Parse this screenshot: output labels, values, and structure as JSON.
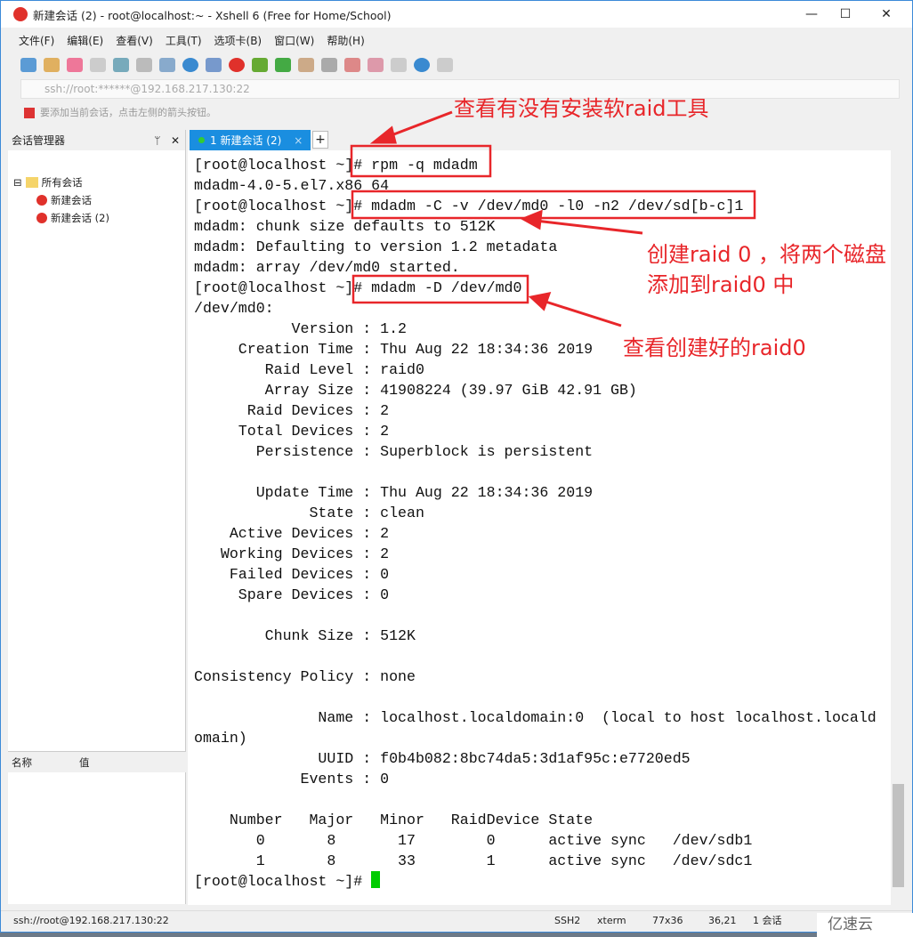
{
  "window": {
    "title": "新建会话 (2) - root@localhost:~ - Xshell 6 (Free for Home/School)",
    "controls": [
      "—",
      "☐",
      "✕"
    ]
  },
  "menu": [
    "文件(F)",
    "编辑(E)",
    "查看(V)",
    "工具(T)",
    "选项卡(B)",
    "窗口(W)",
    "帮助(H)"
  ],
  "address": "ssh://root:******@192.168.217.130:22",
  "hint": "要添加当前会话，点击左侧的箭头按钮。",
  "session_manager": {
    "title": "会话管理器",
    "pin": "ᛘ",
    "close": "✕",
    "root": "所有会话",
    "items": [
      "新建会话",
      "新建会话 (2)"
    ],
    "props_cols": [
      "名称",
      "值"
    ]
  },
  "tab": {
    "label": "1 新建会话 (2)",
    "close": "×",
    "add": "+"
  },
  "terminal_lines": [
    "[root@localhost ~]# rpm -q mdadm",
    "mdadm-4.0-5.el7.x86_64",
    "[root@localhost ~]# mdadm -C -v /dev/md0 -l0 -n2 /dev/sd[b-c]1",
    "mdadm: chunk size defaults to 512K",
    "mdadm: Defaulting to version 1.2 metadata",
    "mdadm: array /dev/md0 started.",
    "[root@localhost ~]# mdadm -D /dev/md0",
    "/dev/md0:",
    "           Version : 1.2",
    "     Creation Time : Thu Aug 22 18:34:36 2019",
    "        Raid Level : raid0",
    "        Array Size : 41908224 (39.97 GiB 42.91 GB)",
    "      Raid Devices : 2",
    "     Total Devices : 2",
    "       Persistence : Superblock is persistent",
    "",
    "       Update Time : Thu Aug 22 18:34:36 2019",
    "             State : clean",
    "    Active Devices : 2",
    "   Working Devices : 2",
    "    Failed Devices : 0",
    "     Spare Devices : 0",
    "",
    "        Chunk Size : 512K",
    "",
    "Consistency Policy : none",
    "",
    "              Name : localhost.localdomain:0  (local to host localhost.locald",
    "omain)",
    "              UUID : f0b4b082:8bc74da5:3d1af95c:e7720ed5",
    "            Events : 0",
    "",
    "    Number   Major   Minor   RaidDevice State",
    "       0       8       17        0      active sync   /dev/sdb1",
    "       1       8       33        1      active sync   /dev/sdc1",
    "[root@localhost ~]# "
  ],
  "annotations": [
    "查看有没有安装软raid工具",
    "创建raid 0 ，将两个磁盘",
    "添加到raid0 中",
    "查看创建好的raid0"
  ],
  "annotation_color": "#e8262a",
  "status": {
    "address": "ssh://root@192.168.217.130:22",
    "protocol": "SSH2",
    "term": "xterm",
    "size": "77x36",
    "pos": "36,21",
    "sessions": "1 会话"
  },
  "watermark": "亿速云"
}
